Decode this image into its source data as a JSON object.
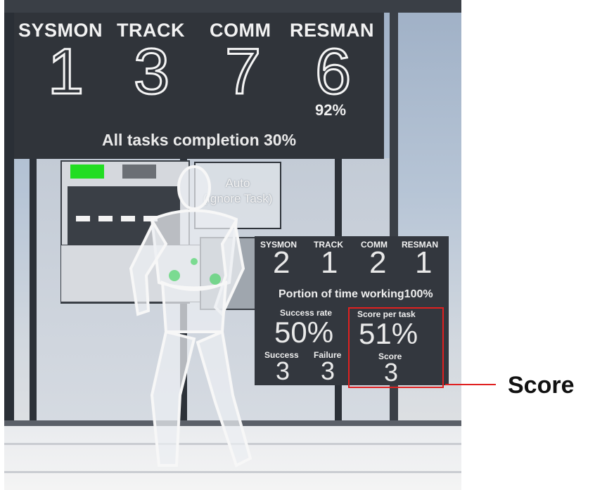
{
  "top_panel": {
    "labels": [
      "SYSMON",
      "TRACK",
      "COMM",
      "RESMAN"
    ],
    "values": [
      "1",
      "3",
      "7",
      "6"
    ],
    "resman_percent": "92%",
    "completion_text": "All tasks completion 30%"
  },
  "auto_panel": {
    "line1": "Auto",
    "line2": "(Ignore Task)"
  },
  "score_panel": {
    "labels": [
      "SYSMON",
      "TRACK",
      "COMM",
      "RESMAN"
    ],
    "values": [
      "2",
      "1",
      "2",
      "1"
    ],
    "portion_text": "Portion of time working100%",
    "success_rate_label": "Success rate",
    "success_rate_value": "50%",
    "score_per_task_label": "Score per task",
    "score_per_task_value": "51%",
    "success_label": "Success",
    "success_value": "3",
    "failure_label": "Failure",
    "failure_value": "3",
    "score_label": "Score",
    "score_value": "3"
  },
  "callout": {
    "label": "Score",
    "color": "#e02020"
  },
  "colors": {
    "panel_bg": "#30343a",
    "indicator_green": "#22dd22"
  }
}
